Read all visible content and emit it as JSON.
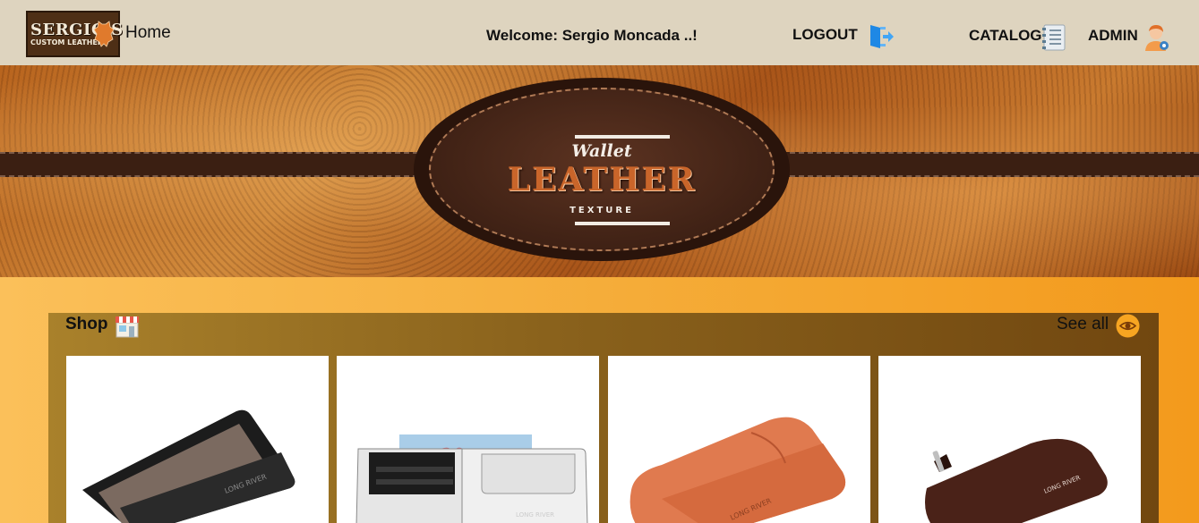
{
  "header": {
    "logo_line1": "SERGIO'S",
    "logo_line2": "CUSTOM LEATHER",
    "home_label": "Home",
    "welcome_text": "Welcome: Sergio Moncada ..!",
    "logout_label": "LOGOUT",
    "catalog_label": "CATALOG",
    "admin_label": "ADMIN"
  },
  "banner": {
    "line1": "Wallet",
    "line2": "LEATHER",
    "line3": "TEXTURE"
  },
  "shop": {
    "title": "Shop",
    "see_all_label": "See all",
    "products": [
      {
        "icon": "black-card-wallet",
        "brand": "LONG RIVER"
      },
      {
        "icon": "white-bifold-wallet",
        "brand": "LONG RIVER"
      },
      {
        "icon": "orange-card-sleeve",
        "brand": "LONG RIVER"
      },
      {
        "icon": "brown-zip-wallet",
        "brand": "LONG RIVER"
      }
    ]
  },
  "colors": {
    "nav_bg": "#ded4bf",
    "page_bg": "#f3a627",
    "panel_bg": "#8a621c"
  }
}
